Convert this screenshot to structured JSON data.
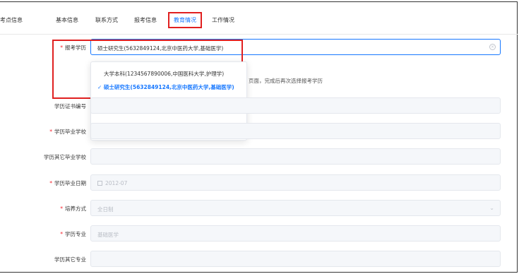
{
  "tabs": [
    {
      "label": "考点信息"
    },
    {
      "label": "基本信息"
    },
    {
      "label": "联系方式"
    },
    {
      "label": "报考信息"
    },
    {
      "label": "教育情况",
      "active": true
    },
    {
      "label": "工作情况"
    }
  ],
  "accent_color": "#1677ff",
  "required_color": "#f5222d",
  "form": {
    "degree": {
      "label": "报考学历",
      "value": "硕士研究生(5632849124,北京中医药大学,基础医学)"
    },
    "hint": "页面，完成后再次选择报考学历",
    "dropdown": [
      {
        "label": "大学本科(1234567890006,中国医科大学,护理学)"
      },
      {
        "label": "硕士研究生(5632849124,北京中医药大学,基础医学)",
        "selected": true,
        "check": "✓"
      }
    ],
    "cert_no": {
      "label": "学历证书编号",
      "value": ""
    },
    "school": {
      "label": "学历毕业学校",
      "value": ""
    },
    "other_school": {
      "label": "学历其它毕业学校",
      "value": ""
    },
    "grad_date": {
      "label": "学历毕业日期",
      "value": "2012-07"
    },
    "training": {
      "label": "培养方式",
      "value": "全日制"
    },
    "major": {
      "label": "学历专业",
      "value": "基础医学"
    },
    "other_major": {
      "label": "学历其它专业",
      "value": ""
    }
  }
}
